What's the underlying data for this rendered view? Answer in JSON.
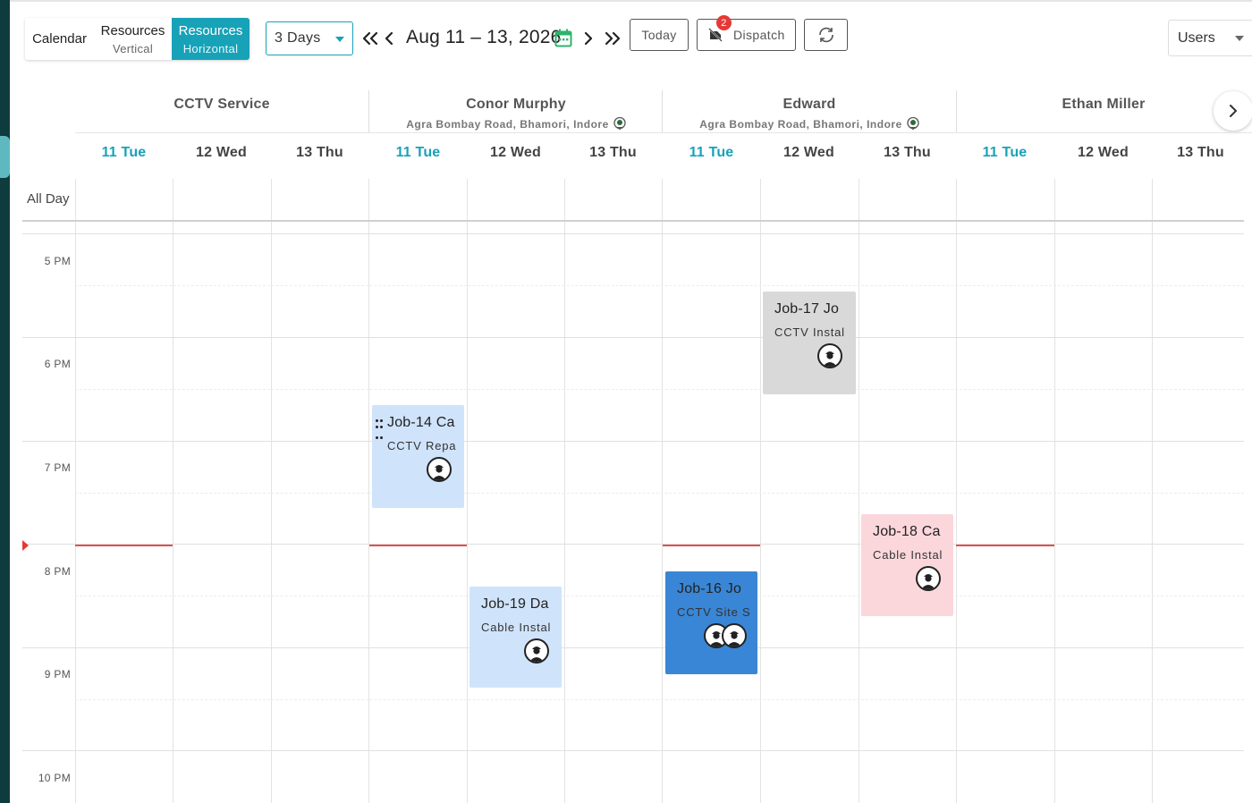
{
  "toolbar": {
    "views": [
      {
        "label": "Calendar",
        "sub": ""
      },
      {
        "label": "Resources",
        "sub": "Vertical"
      },
      {
        "label": "Resources",
        "sub": "Horizontal"
      }
    ],
    "active_view": "Resources Horizontal",
    "range": "3 Days",
    "date_range": "Aug 11 – 13, 2026",
    "today_label": "Today",
    "dispatch_label": "Dispatch",
    "dispatch_count": "2",
    "users_label": "Users"
  },
  "resources": [
    {
      "name": "CCTV Service",
      "address": ""
    },
    {
      "name": "Conor Murphy",
      "address": "Agra Bombay Road, Bhamori, Indore"
    },
    {
      "name": "Edward",
      "address": "Agra Bombay Road, Bhamori, Indore"
    },
    {
      "name": "Ethan Miller",
      "address": ""
    }
  ],
  "days": [
    "11 Tue",
    "12 Wed",
    "13 Thu"
  ],
  "allday_label": "All Day",
  "times": [
    "5 PM",
    "6 PM",
    "7 PM",
    "8 PM",
    "9 PM",
    "10 PM"
  ],
  "events": [
    {
      "title": "Job-17 Jo",
      "subtitle": "CCTV Instal",
      "resource": "Edward",
      "day": "12 Wed",
      "color": "#d9d9d9",
      "assignees": 1
    },
    {
      "title": "Job-14 Ca",
      "subtitle": "CCTV Repa",
      "resource": "Conor Murphy",
      "day": "11 Tue",
      "color": "#cfe3fb",
      "assignees": 1
    },
    {
      "title": "Job-18 Ca",
      "subtitle": "Cable Instal",
      "resource": "Edward",
      "day": "13 Thu",
      "color": "#fbd7dc",
      "assignees": 1
    },
    {
      "title": "Job-19 Da",
      "subtitle": "Cable Instal",
      "resource": "Conor Murphy",
      "day": "12 Wed",
      "color": "#cfe3fb",
      "assignees": 1
    },
    {
      "title": "Job-16 Jo",
      "subtitle": "CCTV Site S",
      "resource": "Edward",
      "day": "11 Tue",
      "color": "#3a86d6",
      "assignees": 2
    }
  ],
  "colors": {
    "accent": "#17a2b8",
    "now_line": "#e05050",
    "sidebar": "#0d3b3e"
  }
}
